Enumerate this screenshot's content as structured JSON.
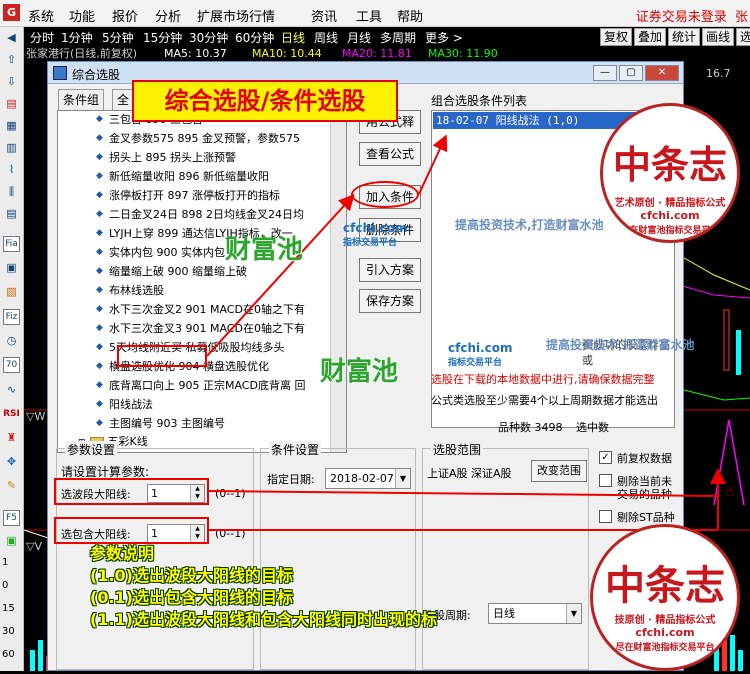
{
  "menubar": {
    "logo": "G",
    "items": [
      "系统",
      "功能",
      "报价",
      "分析",
      "扩展市场行情",
      "资讯",
      "工具",
      "帮助"
    ],
    "status": "证券交易未登录",
    "status2": "张"
  },
  "timeframes": [
    "分时",
    "1分钟",
    "5分钟",
    "15分钟",
    "30分钟",
    "60分钟",
    "日线",
    "周线",
    "月线",
    "多周期",
    "更多 >"
  ],
  "selected_timeframe": "日线",
  "right_buttons": [
    "复权",
    "叠加",
    "统计",
    "画线",
    "选"
  ],
  "subbar": {
    "stock": "张家港行(日线,前复权)",
    "ma5": "MA5: 10.37",
    "ma10": "MA10: 10.44",
    "ma20": "MA20: 11.81",
    "ma30": "MA30: 11.90"
  },
  "left_toolbar": {
    "icon_labels": [
      "Fia",
      "Fiz",
      "70",
      "RSI",
      "F5"
    ],
    "numbers": [
      "1",
      "0",
      "15",
      "30",
      "60"
    ]
  },
  "chart": {
    "price_label": "16.7",
    "vol_label": "▽V",
    "colors": {
      "up": "#ff3232",
      "down": "#00ffff",
      "ma1": "#ffffff",
      "ma2": "#ffff00",
      "ma3": "#ff00ff",
      "ma4": "#00ff00"
    }
  },
  "dialog": {
    "title": "综合选股",
    "window_buttons": [
      "—",
      "▢",
      "✕"
    ],
    "tabs": [
      "条件组",
      "全"
    ],
    "tree_items": [
      "三包含 890 三包含",
      "金叉参数575 895 金叉预警，参数575",
      "拐头上 895 拐头上涨预警",
      "新低缩量收阳 896 新低缩量收阳",
      "涨停板打开 897 涨停板打开的指标",
      "二日金叉24日 898 2日均线金叉24日均",
      "LYJH上穿 899 通达信LYJH指标，改一",
      "实体内包 900 实体内包",
      "缩量缩上破 900 缩量缩上破",
      "布林线选股",
      "水下三次金叉2 901 MACD在0轴之下有",
      "水下三次金叉3 901 MACD在0轴之下有",
      "5天均线附近买 私募低吸股均线多头",
      "横盘选股优化 904 横盘选股优化",
      "底背离口向上 905 正宗MACD底背离 回",
      "阳线战法",
      "主图编号 903 主图编号"
    ],
    "folder": "五彩K线",
    "side_buttons": [
      "用公式释",
      "查看公式",
      "加入条件",
      "删除条件",
      "引入方案",
      "保存方案"
    ],
    "condition_list_label": "组合选股条件列表",
    "condition_list": [
      "18-02-07 阳线战法 (1,0)"
    ],
    "warn_line1": "选股在下载的本地数据中进行,请确保数据完整",
    "warn_line_partial": "都成功的股票作品或",
    "info_line": "公式类选股至少需要4个以上周期数据才能选出",
    "stock_count_label": "品种数",
    "stock_count": "3498",
    "selected_count_label": "选中数",
    "params": {
      "group_title": "参数设置",
      "prompt": "请设置计算参数:",
      "p1_label": "选波段大阳线:",
      "p1_value": "1",
      "p1_range": "(0--1)",
      "p2_label": "选包含大阳线:",
      "p2_value": "1",
      "p2_range": "(0--1)"
    },
    "cond": {
      "group_title": "条件设置",
      "date_label": "指定日期:",
      "date_value": "2018-02-07"
    },
    "range": {
      "group_title": "选股范围",
      "markets": "上证A股 深证A股",
      "change_btn": "改变范围"
    },
    "options": {
      "pre_adj": "前复权数据",
      "exclude_new": "剔除当前未",
      "exclude_new2": "交易的品种",
      "exclude_st": "剔除ST品种"
    },
    "period_label": "选股周期:",
    "period_value": "日线"
  },
  "annotations": {
    "title": "综合选股/条件选股",
    "notes": [
      "参数说明",
      "(1.0)选出波段大阳线的目标",
      "(0.1)选出包含大阳线的目标",
      "(1.1)选出波段大阳线和包含大阳线同时出现的"
    ],
    "note_tail": "标"
  },
  "watermarks": {
    "cn": "财富池",
    "en": "cfchi.com",
    "sub": "指标交易平台",
    "slogan": "提高投资技术,打造财富水池",
    "seal_big": "中条志",
    "seal_line1": "艺术原创 · 精品指标公式",
    "seal_line2": "cfchi.com",
    "seal_line3": "尽在财富池指标交易平台",
    "seal_line1_alt": "技原创 · 精品指标公式"
  }
}
